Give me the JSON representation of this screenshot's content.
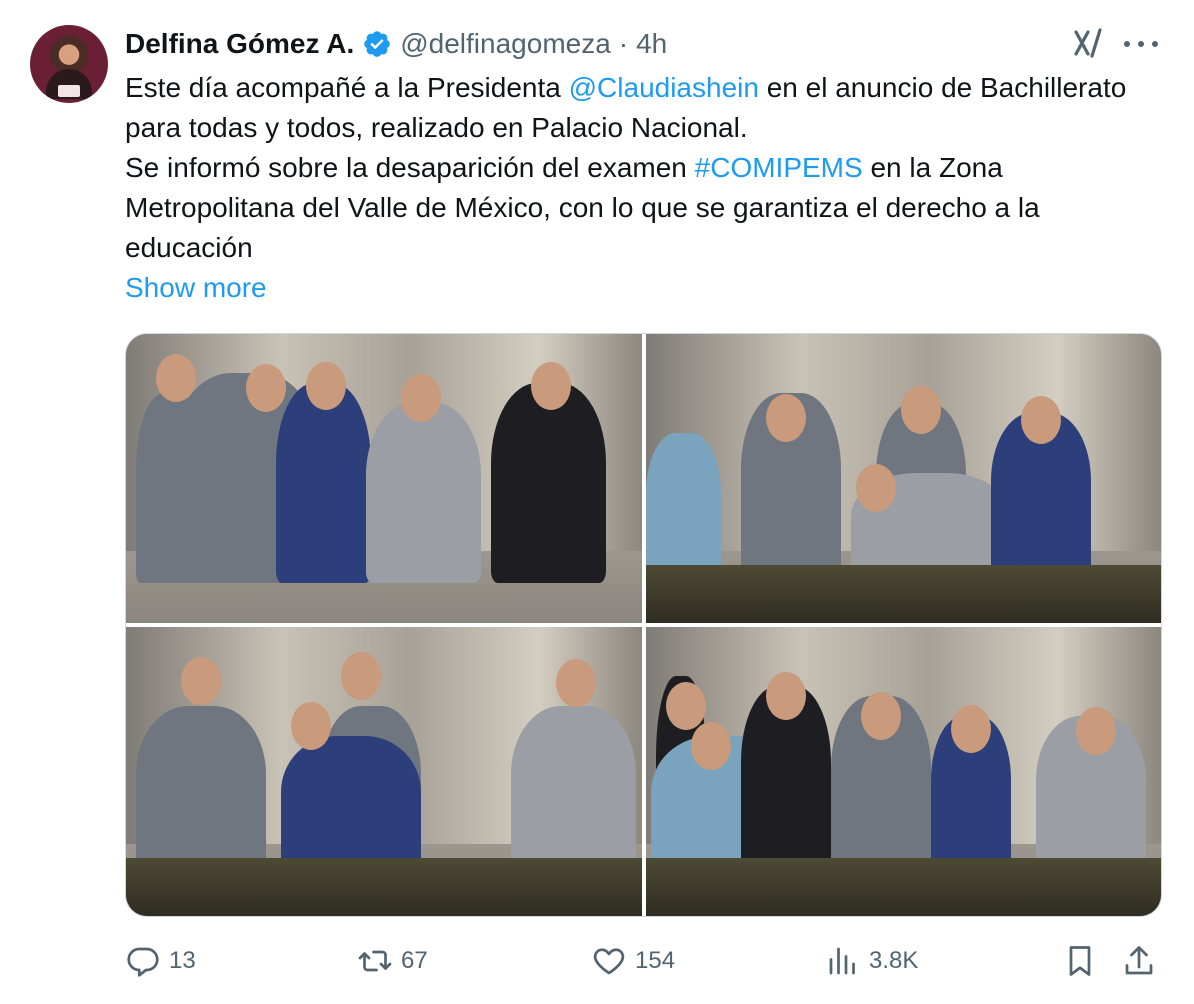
{
  "tweet": {
    "display_name": "Delfina Gómez A.",
    "handle": "@delfinagomeza",
    "separator": "·",
    "time": "4h",
    "text": {
      "line1_pre": "Este día acompañé a la Presidenta ",
      "mention": "@Claudiashein",
      "line1_post": " en el anuncio de Bachillerato para todas y todos, realizado en Palacio Nacional.",
      "line2_pre": "Se informó sobre la desaparición del examen ",
      "hashtag": "#COMIPEMS",
      "line2_post": " en la Zona Metropolitana del Valle de México, con lo que se garantiza el derecho a la educación"
    },
    "show_more": "Show more",
    "media_count": 4
  },
  "actions": {
    "replies": "13",
    "reposts": "67",
    "likes": "154",
    "views": "3.8K"
  },
  "icons": {
    "verified": "verified-badge-icon",
    "grok": "grok-icon",
    "more": "more-icon",
    "reply": "reply-icon",
    "repost": "repost-icon",
    "like": "heart-icon",
    "views": "views-chart-icon",
    "bookmark": "bookmark-icon",
    "share": "share-icon"
  },
  "colors": {
    "accent": "#1d9bf0",
    "text_primary": "#0f1419",
    "text_secondary": "#536471",
    "border": "#cfd9de"
  }
}
